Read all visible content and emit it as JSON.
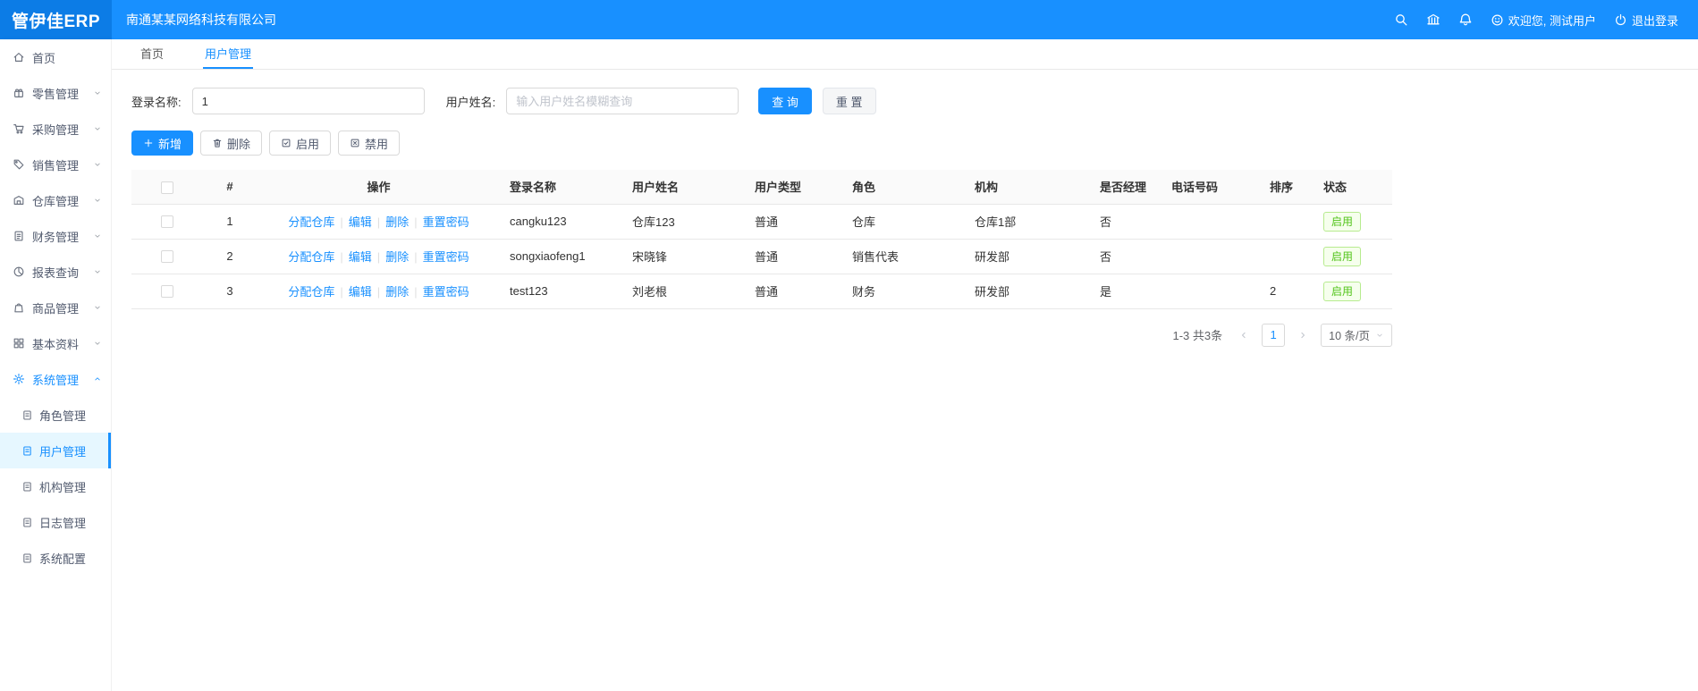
{
  "colors": {
    "primary": "#1890ff",
    "success": "#52c41a",
    "topbar": "#1890ff",
    "logo_bg": "#0c7ce6"
  },
  "topbar": {
    "logo": "管伊佳ERP",
    "company": "南通某某网络科技有限公司",
    "welcome": "欢迎您, 测试用户",
    "logout": "退出登录"
  },
  "sidebar": {
    "items": [
      {
        "key": "home",
        "label": "首页",
        "icon": "home-icon"
      },
      {
        "key": "retail",
        "label": "零售管理",
        "icon": "retail-icon",
        "chevron": "down"
      },
      {
        "key": "purchase",
        "label": "采购管理",
        "icon": "purchase-icon",
        "chevron": "down"
      },
      {
        "key": "sales",
        "label": "销售管理",
        "icon": "sales-icon",
        "chevron": "down"
      },
      {
        "key": "warehouse",
        "label": "仓库管理",
        "icon": "warehouse-icon",
        "chevron": "down"
      },
      {
        "key": "finance",
        "label": "财务管理",
        "icon": "finance-icon",
        "chevron": "down"
      },
      {
        "key": "report",
        "label": "报表查询",
        "icon": "report-icon",
        "chevron": "down"
      },
      {
        "key": "goods",
        "label": "商品管理",
        "icon": "goods-icon",
        "chevron": "down"
      },
      {
        "key": "basic",
        "label": "基本资料",
        "icon": "basic-icon",
        "chevron": "down"
      },
      {
        "key": "system",
        "label": "系统管理",
        "icon": "system-icon",
        "chevron": "up",
        "active": true,
        "children": [
          {
            "key": "role",
            "label": "角色管理",
            "icon": "doc-icon"
          },
          {
            "key": "user",
            "label": "用户管理",
            "icon": "doc-icon",
            "selected": true
          },
          {
            "key": "org",
            "label": "机构管理",
            "icon": "doc-icon"
          },
          {
            "key": "log",
            "label": "日志管理",
            "icon": "doc-icon"
          },
          {
            "key": "config",
            "label": "系统配置",
            "icon": "doc-icon"
          }
        ]
      }
    ]
  },
  "tabs": [
    {
      "key": "home",
      "label": "首页"
    },
    {
      "key": "user",
      "label": "用户管理",
      "active": true
    }
  ],
  "filters": {
    "login_label": "登录名称:",
    "login_value": "1",
    "name_label": "用户姓名:",
    "name_placeholder": "输入用户姓名模糊查询",
    "search": "查 询",
    "reset": "重 置"
  },
  "toolbar": {
    "add": "新增",
    "delete": "删除",
    "enable": "启用",
    "disable": "禁用"
  },
  "table": {
    "headers": [
      "#",
      "操作",
      "登录名称",
      "用户姓名",
      "用户类型",
      "角色",
      "机构",
      "是否经理",
      "电话号码",
      "排序",
      "状态"
    ],
    "rows": [
      {
        "index": "1",
        "ops": [
          "分配仓库",
          "编辑",
          "删除",
          "重置密码"
        ],
        "login": "cangku123",
        "name": "仓库123",
        "type": "普通",
        "role": "仓库",
        "org": "仓库1部",
        "manager": "否",
        "phone": "",
        "sort": "",
        "status": "启用"
      },
      {
        "index": "2",
        "ops": [
          "分配仓库",
          "编辑",
          "删除",
          "重置密码"
        ],
        "login": "songxiaofeng1",
        "name": "宋晓锋",
        "type": "普通",
        "role": "销售代表",
        "org": "研发部",
        "manager": "否",
        "phone": "",
        "sort": "",
        "status": "启用"
      },
      {
        "index": "3",
        "ops": [
          "分配仓库",
          "编辑",
          "删除",
          "重置密码"
        ],
        "login": "test123",
        "name": "刘老根",
        "type": "普通",
        "role": "财务",
        "org": "研发部",
        "manager": "是",
        "phone": "",
        "sort": "2",
        "status": "启用"
      }
    ]
  },
  "pagination": {
    "total": "1-3 共3条",
    "page": "1",
    "page_size": "10 条/页"
  }
}
